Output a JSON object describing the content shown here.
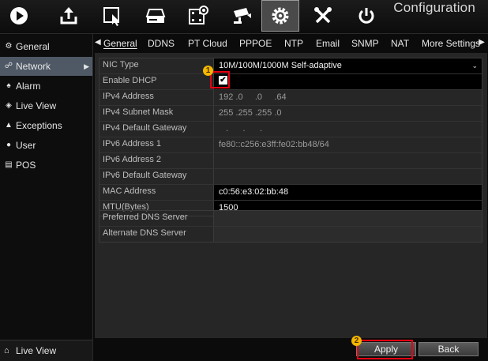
{
  "app_title": "Configuration",
  "toolbar": {
    "items": [
      {
        "icon": "play-icon"
      },
      {
        "icon": "export-icon"
      },
      {
        "icon": "manual-icon"
      },
      {
        "icon": "hdd-icon"
      },
      {
        "icon": "record-icon"
      },
      {
        "icon": "camera-icon"
      },
      {
        "icon": "gear-icon",
        "active": true
      },
      {
        "icon": "maintenance-icon"
      },
      {
        "icon": "power-icon"
      }
    ]
  },
  "sidebar": {
    "items": [
      {
        "label": "General",
        "icon": "gear-icon"
      },
      {
        "label": "Network",
        "icon": "network-icon",
        "active": true
      },
      {
        "label": "Alarm",
        "icon": "alarm-icon"
      },
      {
        "label": "Live View",
        "icon": "eye-icon"
      },
      {
        "label": "Exceptions",
        "icon": "warning-icon"
      },
      {
        "label": "User",
        "icon": "user-icon"
      },
      {
        "label": "POS",
        "icon": "pos-icon"
      }
    ],
    "bottom": {
      "label": "Live View",
      "icon": "home-icon"
    }
  },
  "tabs": {
    "items": [
      "General",
      "DDNS",
      "PT Cloud",
      "PPPOE",
      "NTP",
      "Email",
      "SNMP",
      "NAT",
      "More Settings"
    ],
    "active_index": 0
  },
  "form": {
    "nic_type": {
      "label": "NIC Type",
      "value": "10M/100M/1000M Self-adaptive"
    },
    "enable_dhcp": {
      "label": "Enable DHCP",
      "checked": true,
      "check_glyph": "✔"
    },
    "ipv4_address": {
      "label": "IPv4 Address",
      "value": "192 .0     .0     .64"
    },
    "ipv4_subnet": {
      "label": "IPv4 Subnet Mask",
      "value": "255 .255 .255 .0"
    },
    "ipv4_gateway": {
      "label": "IPv4 Default Gateway",
      "value": "   .      .      ."
    },
    "ipv6_address1": {
      "label": "IPv6 Address 1",
      "value": "fe80::c256:e3ff:fe02:bb48/64"
    },
    "ipv6_address2": {
      "label": "IPv6 Address 2",
      "value": ""
    },
    "ipv6_gateway": {
      "label": "IPv6 Default Gateway",
      "value": ""
    },
    "mac_address": {
      "label": "MAC Address",
      "value": "c0:56:e3:02:bb:48"
    },
    "mtu": {
      "label": "MTU(Bytes)",
      "value": "1500"
    }
  },
  "dns": {
    "preferred": {
      "label": "Preferred DNS Server",
      "value": ""
    },
    "alternate": {
      "label": "Alternate DNS Server",
      "value": ""
    }
  },
  "buttons": {
    "apply": "Apply",
    "back": "Back"
  },
  "annotations": {
    "step1": "1",
    "step2": "2"
  },
  "colors": {
    "highlight": "#e60012",
    "badge": "#f5b800",
    "active_sidebar": "#4f5966"
  }
}
